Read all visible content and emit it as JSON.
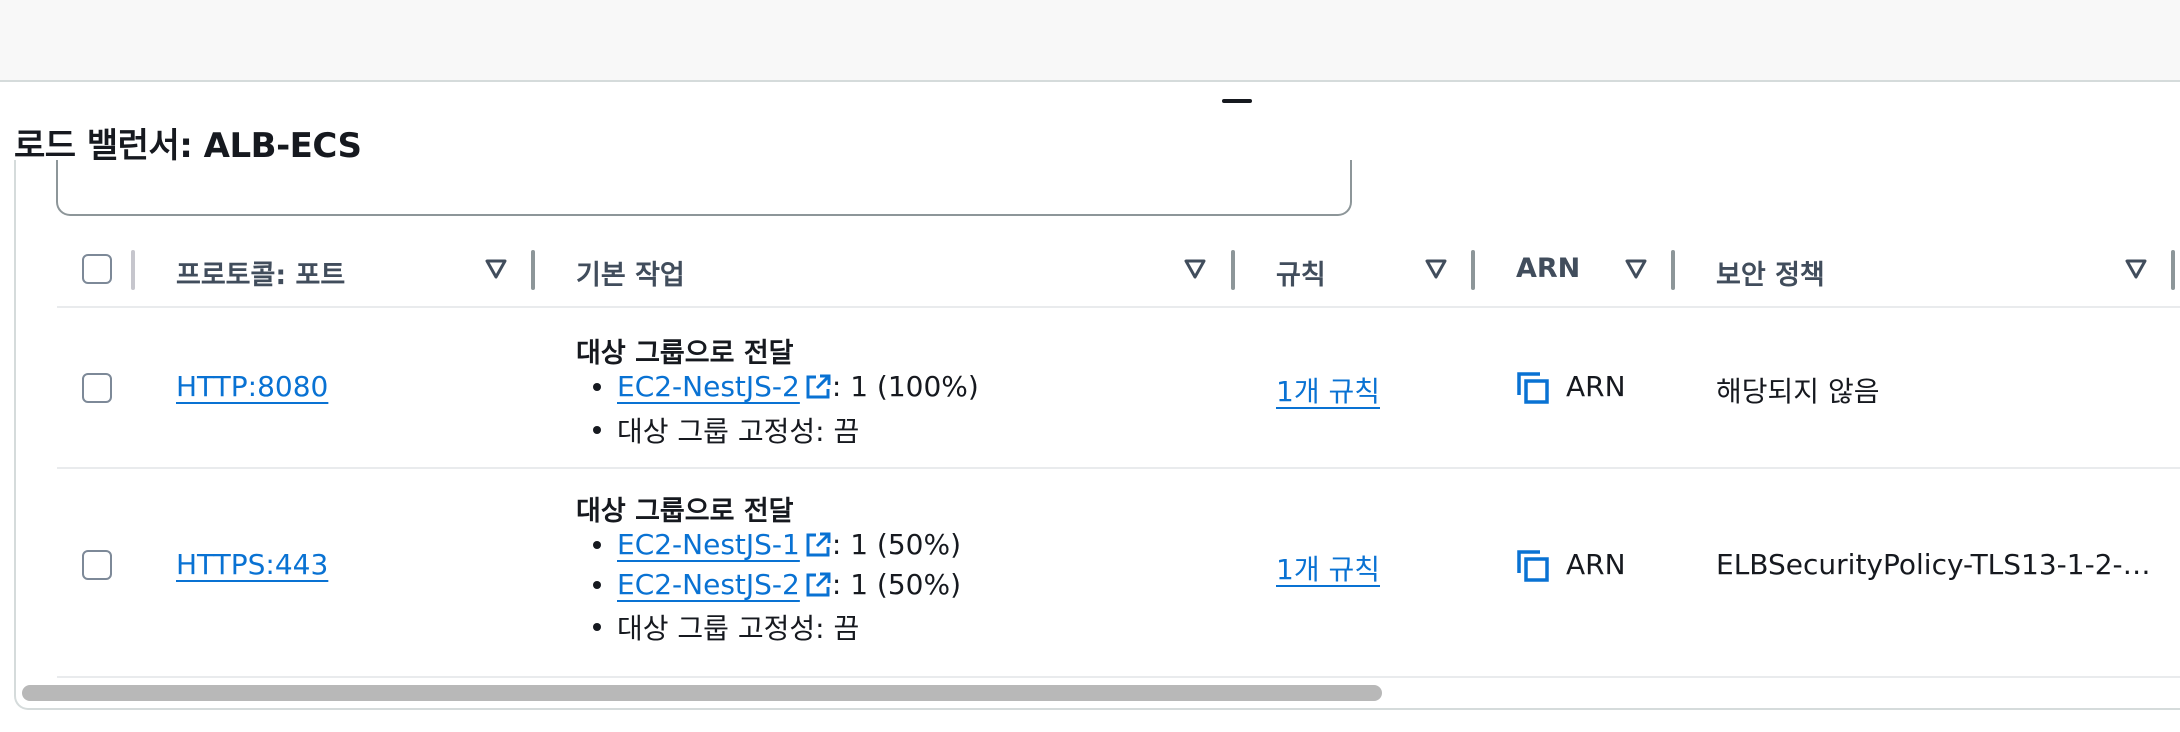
{
  "panel": {
    "title": "로드 밸런서: ALB-ECS"
  },
  "table": {
    "columns": [
      {
        "label": "프로토콜: 포트"
      },
      {
        "label": "기본 작업"
      },
      {
        "label": "규칙"
      },
      {
        "label": "ARN"
      },
      {
        "label": "보안 정책"
      }
    ],
    "rows": [
      {
        "protocol_port": "HTTP:8080",
        "action_title": "대상 그룹으로 전달",
        "targets": [
          {
            "name": "EC2-NestJS-2",
            "weight": ": 1 (100%)"
          }
        ],
        "stickiness": "대상 그룹 고정성: 끔",
        "rules": "1개 규칙",
        "arn": "ARN",
        "security_policy": "해당되지 않음"
      },
      {
        "protocol_port": "HTTPS:443",
        "action_title": "대상 그룹으로 전달",
        "targets": [
          {
            "name": "EC2-NestJS-1",
            "weight": ": 1 (50%)"
          },
          {
            "name": "EC2-NestJS-2",
            "weight": ": 1 (50%)"
          }
        ],
        "stickiness": "대상 그룹 고정성: 끔",
        "rules": "1개 규칙",
        "arn": "ARN",
        "security_policy": "ELBSecurityPolicy-TLS13-1-2-…"
      }
    ]
  },
  "icons": {
    "sort": "caret-down-icon",
    "external": "external-link-icon",
    "copy": "copy-icon"
  },
  "colors": {
    "link": "#0972d3",
    "header_text": "#414d5c",
    "text": "#16191f"
  }
}
